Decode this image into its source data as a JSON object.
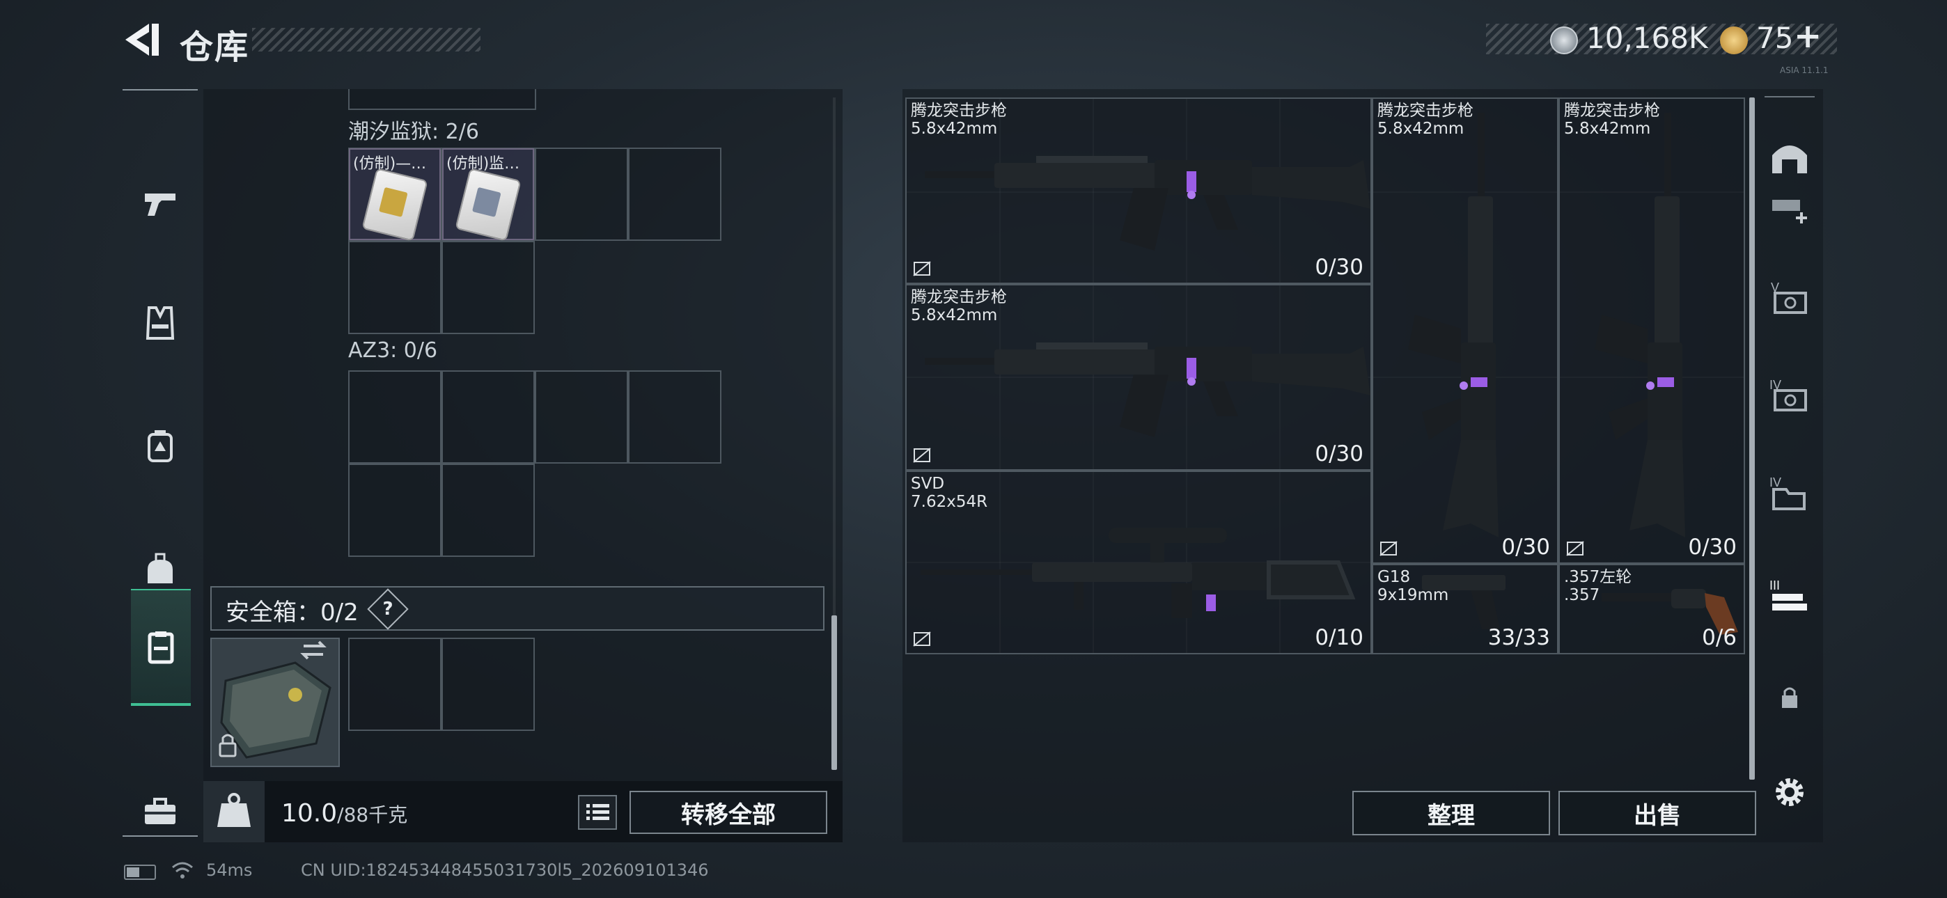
{
  "header": {
    "title": "仓库",
    "coin_value": "10,168K",
    "ticket_value": "75",
    "ticket_plus": "+",
    "version": "ASIA 11.1.1"
  },
  "left_rail": {
    "items": [
      {
        "name": "pistol",
        "icon": "pistol-icon"
      },
      {
        "name": "vest",
        "icon": "vest-icon"
      },
      {
        "name": "backpack",
        "icon": "backpack-icon"
      },
      {
        "name": "bag",
        "icon": "bag-icon"
      },
      {
        "name": "safe-box",
        "icon": "clipboard-icon",
        "active": true
      },
      {
        "name": "toolbox",
        "icon": "toolbox-icon"
      }
    ]
  },
  "inventory": {
    "section1": {
      "label": "潮汐监狱: 2/6",
      "items": [
        {
          "label": "(仿制)—…",
          "color": "#c9a640"
        },
        {
          "label": "(仿制)监…",
          "color": "#7d8aa0"
        }
      ]
    },
    "section2": {
      "label": "AZ3: 0/6"
    },
    "safe_box": {
      "label": "安全箱：0/2",
      "help": "?"
    },
    "weight": {
      "current": "10.0",
      "max": "/88千克"
    },
    "kg_label": "KG",
    "transfer_all": "转移全部"
  },
  "storage": {
    "weapons": [
      {
        "name": "腾龙突击步枪",
        "caliber": "5.8x42mm",
        "ammo": "0/30"
      },
      {
        "name": "腾龙突击步枪",
        "caliber": "5.8x42mm",
        "ammo": "0/30"
      },
      {
        "name": "腾龙突击步枪",
        "caliber": "5.8x42mm",
        "ammo": "0/30"
      },
      {
        "name": "腾龙突击步枪",
        "caliber": "5.8x42mm",
        "ammo": "0/30"
      },
      {
        "name": "SVD",
        "caliber": "7.62x54R",
        "ammo": "0/10"
      },
      {
        "name": "G18",
        "caliber": "9x19mm",
        "ammo": "33/33"
      },
      {
        "name": ".357左轮",
        "caliber": ".357",
        "ammo": "0/6"
      }
    ],
    "sort_button": "整理",
    "sell_button": "出售"
  },
  "status": {
    "ping": "54ms",
    "uid": "CN UID:182453448455031730l5_202609101346"
  },
  "colors": {
    "accent_green": "#3fbf93",
    "attachment_purple": "#9b5de5"
  }
}
